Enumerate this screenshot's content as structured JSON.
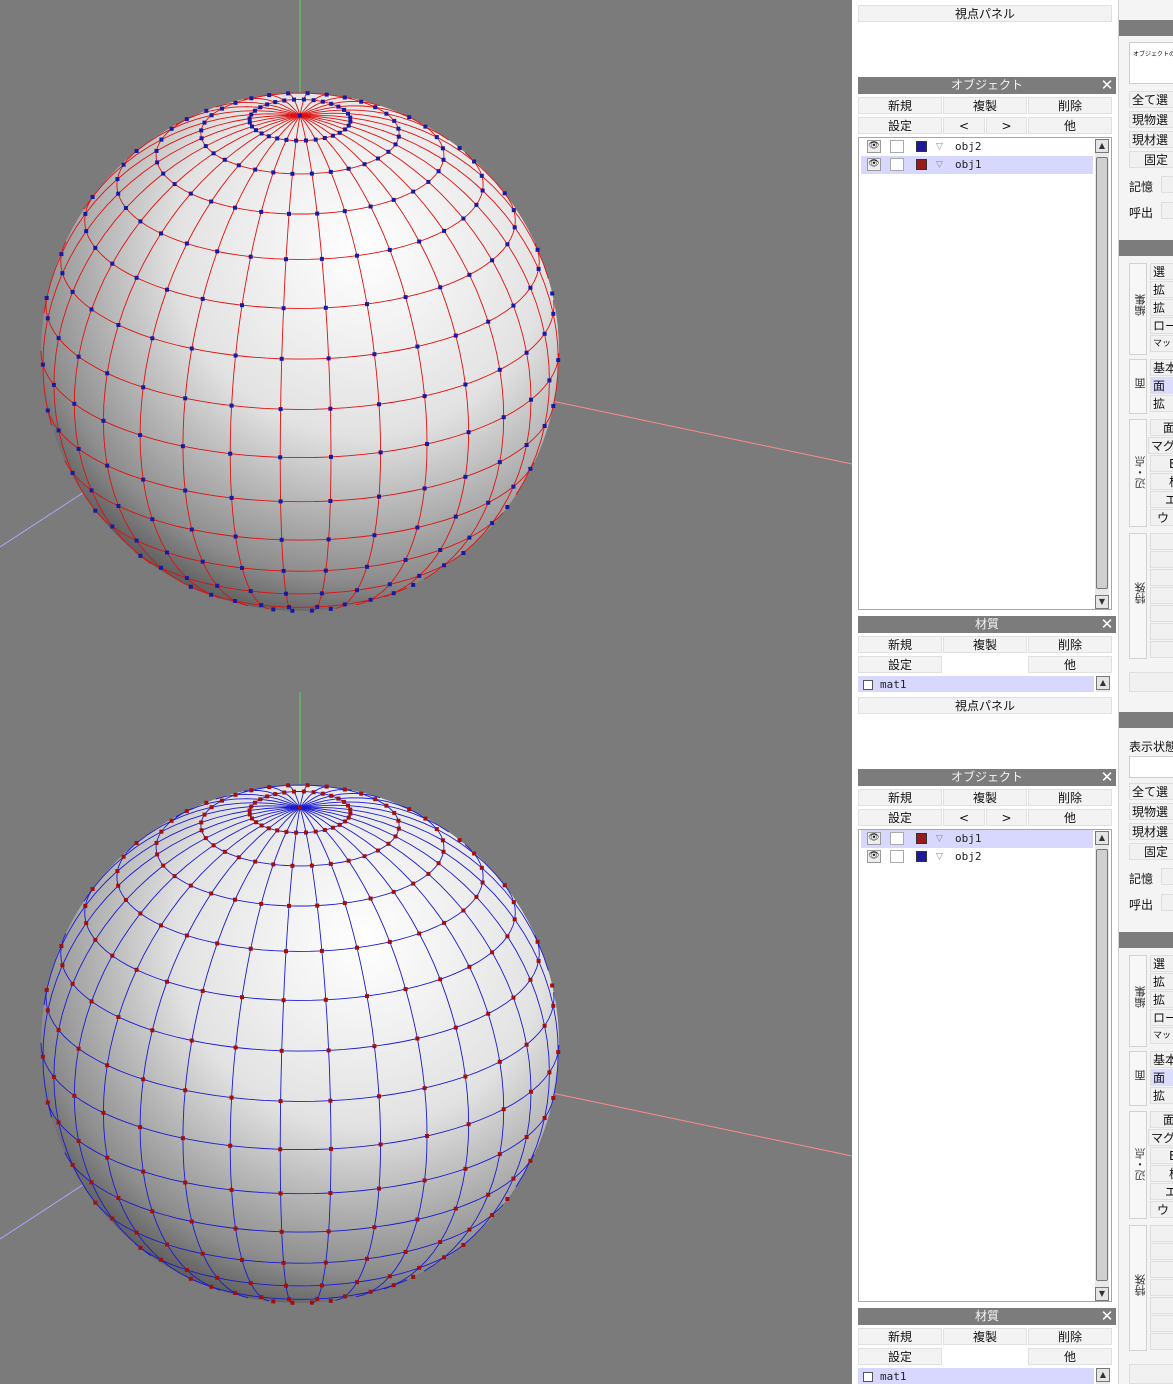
{
  "panels": [
    {
      "id": "top",
      "wire_color": "#e01010",
      "point_color": "#1a1aa0",
      "view_panel_label": "視点パネル",
      "object_panel": {
        "title": "オブジェクト",
        "close": "✕",
        "buttons_row1": [
          "新規",
          "複製",
          "削除"
        ],
        "buttons_row2": [
          "設定",
          "<",
          ">",
          "他"
        ],
        "objects": [
          {
            "name": "obj2",
            "color": "#1a1a9a",
            "selected": false
          },
          {
            "name": "obj1",
            "color": "#9a1a1a",
            "selected": true
          }
        ]
      },
      "material_panel": {
        "title": "材質",
        "close": "✕",
        "buttons_row1": [
          "新規",
          "複製",
          "削除"
        ],
        "buttons_row2": [
          "設定",
          "他"
        ],
        "materials": [
          {
            "name": "mat1"
          }
        ]
      },
      "right": {
        "top_label": "オブジェクトの",
        "buttons": [
          "全て選",
          "現物選",
          "現材選",
          "固定"
        ],
        "memory": "記憶",
        "recall": "呼出",
        "group_edit": "編集",
        "edit_items": [
          "選",
          "拡",
          "拡",
          "ロー",
          "マッ"
        ],
        "group_face": "面",
        "face_items": [
          "基本",
          "面",
          "拡"
        ],
        "group_edge": "辺・点",
        "edge_items": [
          "面",
          "マグ",
          "B",
          "板",
          "エ",
          "ウ"
        ],
        "group_special": "特殊"
      }
    },
    {
      "id": "bottom",
      "wire_color": "#1a1ad0",
      "point_color": "#a01010",
      "view_panel_label": "視点パネル",
      "object_panel": {
        "title": "オブジェクト",
        "close": "✕",
        "buttons_row1": [
          "新規",
          "複製",
          "削除"
        ],
        "buttons_row2": [
          "設定",
          "<",
          ">",
          "他"
        ],
        "objects": [
          {
            "name": "obj1",
            "color": "#9a1a1a",
            "selected": true
          },
          {
            "name": "obj2",
            "color": "#1a1a9a",
            "selected": false
          }
        ]
      },
      "material_panel": {
        "title": "材質",
        "close": "✕",
        "buttons_row1": [
          "新規",
          "複製",
          "削除"
        ],
        "buttons_row2": [
          "設定",
          "他"
        ],
        "materials": [
          {
            "name": "mat1"
          }
        ]
      },
      "right": {
        "top_label": "表示状態",
        "buttons": [
          "全て選",
          "現物選",
          "現材選",
          "固定"
        ],
        "memory": "記憶",
        "recall": "呼出",
        "group_edit": "編集",
        "edit_items": [
          "選",
          "拡",
          "拡",
          "ロー",
          "マッ"
        ],
        "group_face": "面",
        "face_items": [
          "基本",
          "面",
          "拡"
        ],
        "group_edge": "辺・点",
        "edge_items": [
          "面",
          "マグ",
          "B",
          "板",
          "エ",
          "ウ"
        ],
        "group_special": "特殊"
      }
    }
  ]
}
